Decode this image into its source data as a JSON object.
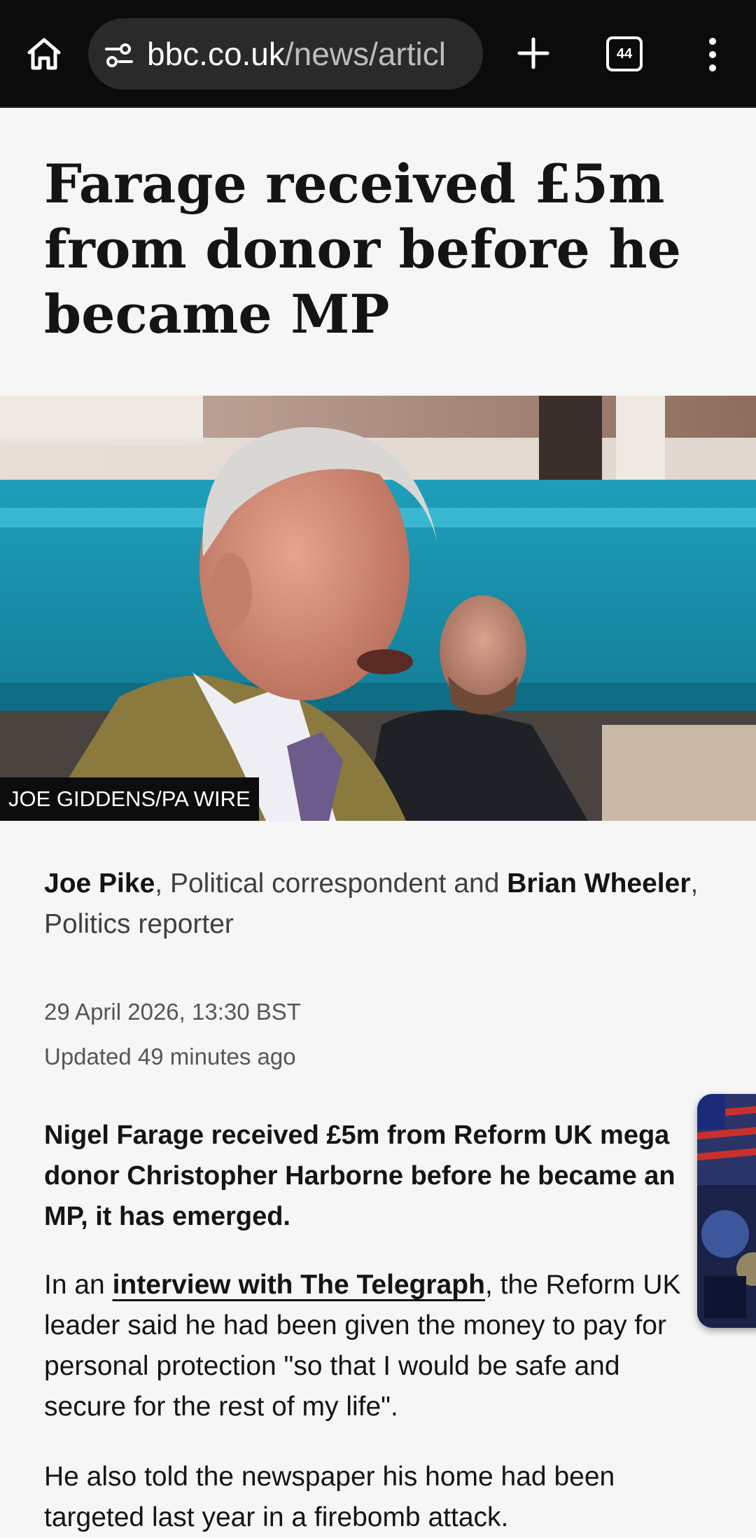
{
  "browser": {
    "url_domain": "bbc.co.uk",
    "url_path": "/news/articl",
    "tab_count": "44",
    "icons": [
      "home-icon",
      "site-settings-icon",
      "new-tab-plus-icon",
      "tab-switcher-icon",
      "more-vert-icon"
    ]
  },
  "article": {
    "headline": "Farage received £5m from donor before he became MP",
    "image_credit": "JOE GIDDENS/PA WIRE",
    "byline": {
      "author1": "Joe Pike",
      "role1": ", Political correspondent and ",
      "author2": "Brian Wheeler",
      "role2": ", Politics reporter"
    },
    "date": "29 April 2026, 13:30 BST",
    "updated": "Updated 49 minutes ago",
    "lead": "Nigel Farage received £5m from Reform UK mega donor Christopher Harborne before he became an MP, it has emerged.",
    "para1_before": "In an ",
    "para1_link": "interview with The Telegraph",
    "para1_after": ", the Reform UK leader said he had been given the money to pay for personal protection \"so that I would be safe and secure for the rest of my life\".",
    "para2": "He also told the newspaper his home had been targeted last year in a firebomb attack."
  },
  "colors": {
    "toolbar_bg": "#0b0b0b",
    "urlbar_bg": "#2a2a2a",
    "page_bg": "#f6f6f6",
    "text": "#141414",
    "meta_text": "#545658"
  }
}
